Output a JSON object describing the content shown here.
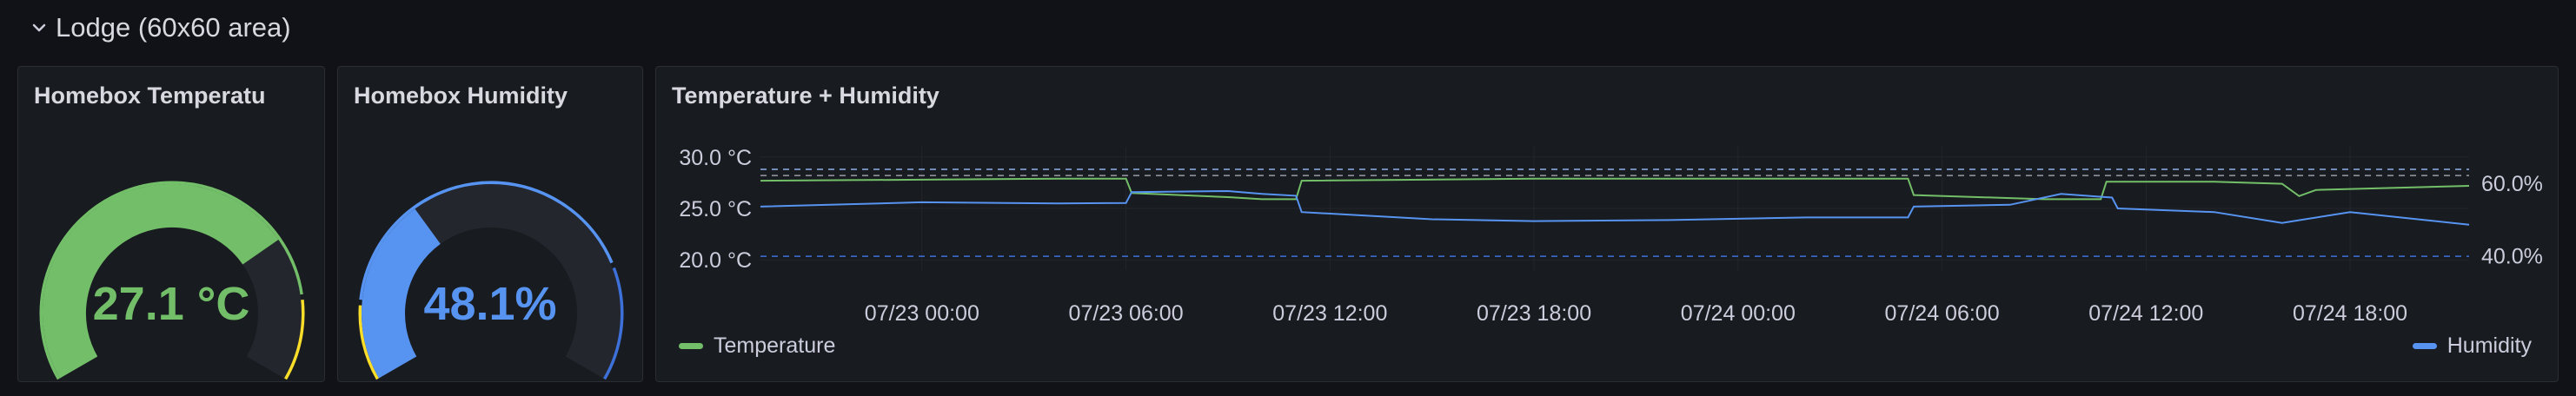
{
  "row": {
    "title": "Lodge (60x60 area)",
    "icon": "chevron-down-icon"
  },
  "panels": {
    "temperature_gauge": {
      "title": "Homebox Temperatu",
      "value_text": "27.1 °C",
      "value": 27.1,
      "fill_fraction": 0.73,
      "color": "#73bf69"
    },
    "humidity_gauge": {
      "title": "Homebox Humidity",
      "value_text": "48.1%",
      "value": 48.1,
      "fill_fraction": 0.35,
      "color": "#5794f2"
    },
    "timeseries": {
      "title": "Temperature + Humidity",
      "legend": [
        {
          "label": "Temperature",
          "color": "#73bf69"
        },
        {
          "label": "Humidity",
          "color": "#5794f2"
        }
      ]
    }
  },
  "chart_data": {
    "type": "line",
    "x_ticks": [
      "07/23 00:00",
      "07/23 06:00",
      "07/23 12:00",
      "07/23 18:00",
      "07/24 00:00",
      "07/24 06:00",
      "07/24 12:00",
      "07/24 18:00"
    ],
    "y_left_ticks": [
      "30.0 °C",
      "25.0 °C",
      "20.0 °C"
    ],
    "y_right_ticks": [
      "60.0%",
      "40.0%"
    ],
    "y_left_range": [
      19,
      31
    ],
    "y_right_range": [
      36,
      70
    ],
    "x_range": [
      "07/22 19:15",
      "07/24 21:30"
    ],
    "threshold_lines": [
      28.2,
      28.8,
      39.8
    ],
    "series": [
      {
        "name": "Temperature",
        "axis": "left",
        "color": "#73bf69",
        "x": [
          "07/22 19:15",
          "07/23 00:00",
          "07/23 04:00",
          "07/23 06:00",
          "07/23 06:10",
          "07/23 09:00",
          "07/23 10:00",
          "07/23 11:00",
          "07/23 11:10",
          "07/23 18:00",
          "07/23 22:00",
          "07/24 02:00",
          "07/24 05:00",
          "07/24 05:10",
          "07/24 09:00",
          "07/24 10:40",
          "07/24 10:50",
          "07/24 14:00",
          "07/24 16:00",
          "07/24 16:30",
          "07/24 17:00",
          "07/24 21:30"
        ],
        "values": [
          27.7,
          27.8,
          27.9,
          27.9,
          26.5,
          26.1,
          25.9,
          25.9,
          27.7,
          27.9,
          27.9,
          27.9,
          27.9,
          26.3,
          25.9,
          25.9,
          27.6,
          27.6,
          27.4,
          26.2,
          26.8,
          27.2
        ]
      },
      {
        "name": "Humidity",
        "axis": "right",
        "color": "#5794f2",
        "x": [
          "07/22 19:15",
          "07/23 00:00",
          "07/23 04:00",
          "07/23 06:00",
          "07/23 06:10",
          "07/23 09:00",
          "07/23 10:00",
          "07/23 11:00",
          "07/23 11:10",
          "07/23 15:00",
          "07/23 18:00",
          "07/23 22:00",
          "07/24 02:00",
          "07/24 05:00",
          "07/24 05:10",
          "07/24 08:00",
          "07/24 09:30",
          "07/24 11:00",
          "07/24 11:10",
          "07/24 14:00",
          "07/24 16:00",
          "07/24 18:00",
          "07/24 21:30"
        ],
        "values": [
          53.5,
          54.7,
          54.4,
          54.5,
          57.5,
          57.8,
          57.0,
          56.5,
          52.0,
          50.0,
          49.5,
          49.8,
          50.5,
          50.5,
          53.5,
          54.0,
          57.0,
          56.0,
          53.0,
          52.0,
          49.0,
          52.0,
          48.5
        ]
      }
    ]
  }
}
